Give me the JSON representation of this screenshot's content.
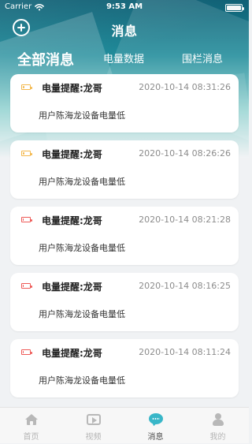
{
  "status_bar": {
    "carrier": "Carrier",
    "time": "9:53 AM"
  },
  "header": {
    "title": "消息",
    "add_icon": "plus-circle-icon"
  },
  "tabs": [
    {
      "label": "全部消息",
      "active": true
    },
    {
      "label": "电量数据",
      "active": false
    },
    {
      "label": "围栏消息",
      "active": false
    }
  ],
  "messages": [
    {
      "title": "电量提醒:龙哥",
      "time": "2020-10-14 08:31:26",
      "body": "用户陈海龙设备电量低",
      "battery_color": "#f3b84c",
      "battery_level": 0.25
    },
    {
      "title": "电量提醒:龙哥",
      "time": "2020-10-14 08:26:26",
      "body": "用户陈海龙设备电量低",
      "battery_color": "#f3b84c",
      "battery_level": 0.25
    },
    {
      "title": "电量提醒:龙哥",
      "time": "2020-10-14 08:21:28",
      "body": "用户陈海龙设备电量低",
      "battery_color": "#ee5a57",
      "battery_level": 0.12
    },
    {
      "title": "电量提醒:龙哥",
      "time": "2020-10-14 08:16:25",
      "body": "用户陈海龙设备电量低",
      "battery_color": "#ee5a57",
      "battery_level": 0.12
    },
    {
      "title": "电量提醒:龙哥",
      "time": "2020-10-14 08:11:24",
      "body": "用户陈海龙设备电量低",
      "battery_color": "#ee5a57",
      "battery_level": 0.12
    }
  ],
  "bottom_nav": [
    {
      "label": "首页",
      "icon": "home-icon",
      "active": false
    },
    {
      "label": "视频",
      "icon": "video-icon",
      "active": false
    },
    {
      "label": "消息",
      "icon": "chat-bubble-icon",
      "active": true
    },
    {
      "label": "我的",
      "icon": "user-icon",
      "active": false
    }
  ],
  "colors": {
    "accent": "#38b6c8",
    "header_dark": "#0d5f74",
    "header_mid": "#1f8b9a",
    "background": "#f0f2f4"
  }
}
